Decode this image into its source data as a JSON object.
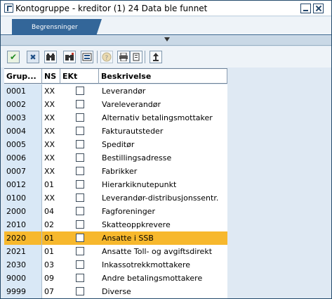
{
  "window": {
    "title": "Kontogruppe - kreditor (1)   24 Data ble funnet"
  },
  "tabs": [
    {
      "label": "Begrensninger",
      "active": true
    }
  ],
  "toolbar": {
    "icons": [
      "check-icon",
      "cancel-icon",
      "binoculars-icon",
      "binoculars-next-icon",
      "select-all-icon",
      "help-icon",
      "print-icon",
      "list-icon",
      "sort-icon"
    ]
  },
  "table": {
    "columns": [
      "Grup...",
      "NS",
      "EKt",
      "Beskrivelse"
    ],
    "rows": [
      {
        "code": "0001",
        "ns": "XX",
        "ek": false,
        "desc": "Leverandør",
        "selected": false
      },
      {
        "code": "0002",
        "ns": "XX",
        "ek": false,
        "desc": "Vareleverandør",
        "selected": false
      },
      {
        "code": "0003",
        "ns": "XX",
        "ek": false,
        "desc": "Alternativ betalingsmottaker",
        "selected": false
      },
      {
        "code": "0004",
        "ns": "XX",
        "ek": false,
        "desc": "Fakturautsteder",
        "selected": false
      },
      {
        "code": "0005",
        "ns": "XX",
        "ek": false,
        "desc": "Speditør",
        "selected": false
      },
      {
        "code": "0006",
        "ns": "XX",
        "ek": false,
        "desc": "Bestillingsadresse",
        "selected": false
      },
      {
        "code": "0007",
        "ns": "XX",
        "ek": false,
        "desc": "Fabrikker",
        "selected": false
      },
      {
        "code": "0012",
        "ns": "01",
        "ek": false,
        "desc": "Hierarkiknutepunkt",
        "selected": false
      },
      {
        "code": "0100",
        "ns": "XX",
        "ek": false,
        "desc": "Leverandør-distribusjonssentr.",
        "selected": false
      },
      {
        "code": "2000",
        "ns": "04",
        "ek": false,
        "desc": "Fagforeninger",
        "selected": false
      },
      {
        "code": "2010",
        "ns": "02",
        "ek": false,
        "desc": "Skatteoppkrevere",
        "selected": false
      },
      {
        "code": "2020",
        "ns": "01",
        "ek": false,
        "desc": "Ansatte i SSB",
        "selected": true
      },
      {
        "code": "2021",
        "ns": "01",
        "ek": false,
        "desc": "Ansatte Toll- og avgiftsdirekt",
        "selected": false
      },
      {
        "code": "2030",
        "ns": "03",
        "ek": false,
        "desc": "Inkassotrekkmottakere",
        "selected": false
      },
      {
        "code": "9000",
        "ns": "09",
        "ek": false,
        "desc": "Andre betalingsmottakere",
        "selected": false
      },
      {
        "code": "9999",
        "ns": "07",
        "ek": false,
        "desc": "Diverse",
        "selected": false
      }
    ]
  },
  "colors": {
    "selection": "#f7b82d",
    "tab_active": "#336699",
    "window_frame": "#254b6c"
  }
}
